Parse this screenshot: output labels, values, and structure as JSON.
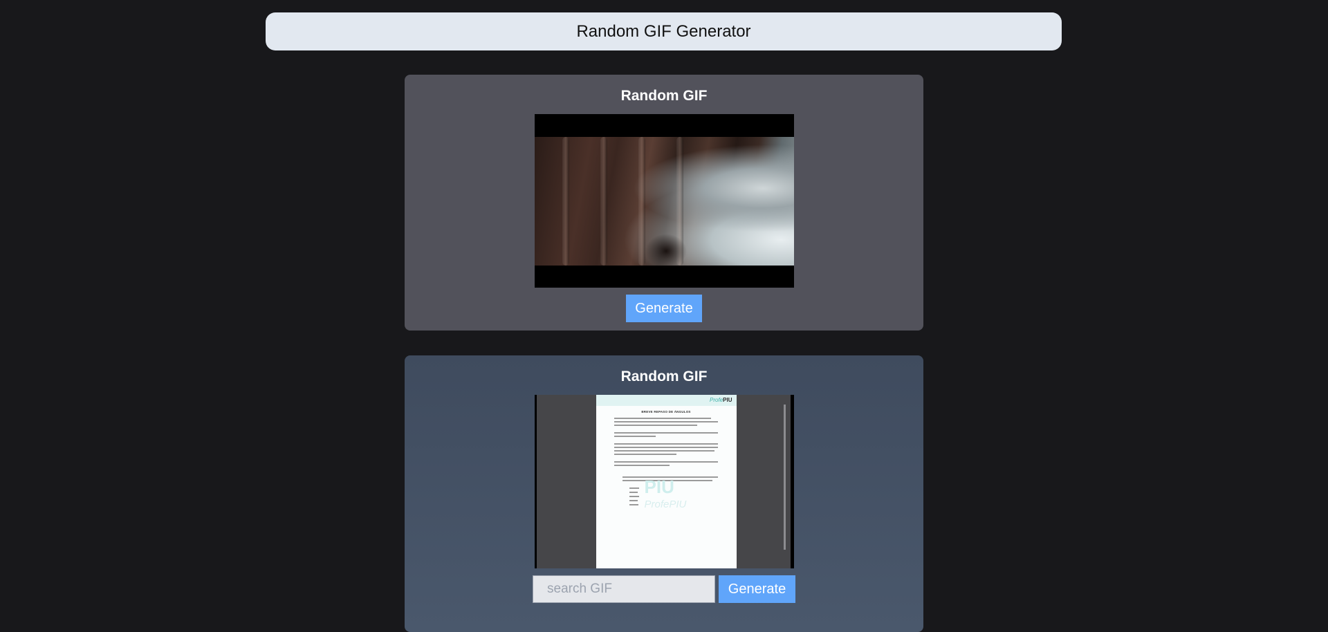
{
  "header": {
    "title": "Random GIF Generator"
  },
  "random_card": {
    "title": "Random GIF",
    "generate_label": "Generate"
  },
  "search_card": {
    "title": "Random GIF",
    "search_placeholder": "search GIF",
    "generate_label": "Generate"
  },
  "colors": {
    "background": "#18181b",
    "header": "#e2e8f0",
    "card_1": "#52525b",
    "card_2": "#44505f",
    "button": "#60a5fa"
  },
  "gif_2_document": {
    "brand_prefix": "Profe",
    "brand_suffix": "PIU",
    "doc_title": "BREVE REPASO DE ÁNGULOS",
    "watermark_top": "PIU",
    "watermark_bottom": "ProfePIU"
  }
}
